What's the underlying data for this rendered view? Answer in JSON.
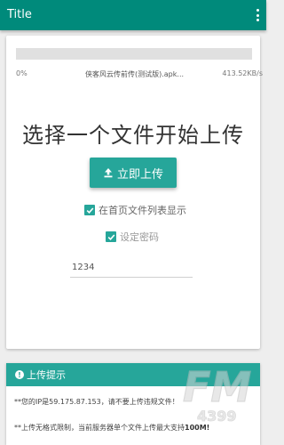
{
  "appbar": {
    "title": "Title",
    "menu_icon": "overflow-menu-icon"
  },
  "upload": {
    "progress_percent": 0,
    "percent_text": "0%",
    "file_name": "侠客风云传前传(测试版).apk...",
    "speed": "413.52KB/s"
  },
  "main": {
    "headline": "选择一个文件开始上传",
    "upload_button_label": "立即上传",
    "upload_button_icon": "upload-icon",
    "show_in_list_label": "在首页文件列表显示",
    "show_in_list_checked": true,
    "set_password_label": "设定密码",
    "set_password_checked": true,
    "password_value": "1234"
  },
  "tips": {
    "header_label": "上传提示",
    "header_icon": "info-icon",
    "line1": "**您的IP是59.175.87.153，请不要上传违规文件！",
    "line2_prefix": "**上传无格式限制，当前服务器单个文件上传最大支持",
    "line2_limit": "100M!"
  },
  "watermark": {
    "text": "FM",
    "subtext": "4399"
  },
  "colors": {
    "appbar": "#008a7b",
    "accent": "#26a69a"
  }
}
